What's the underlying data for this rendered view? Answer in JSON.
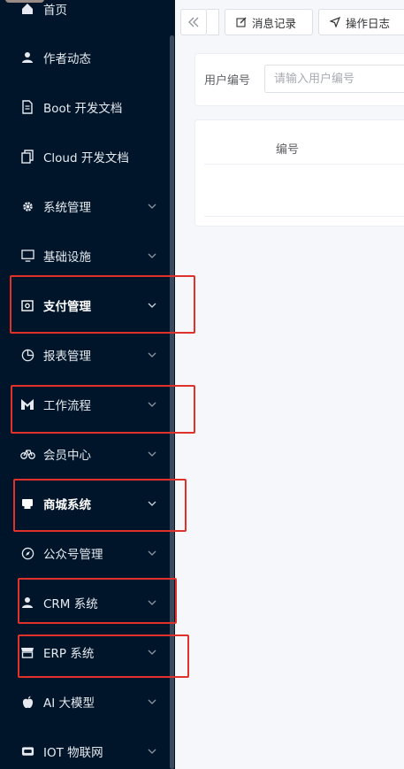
{
  "sidebar": {
    "items": [
      {
        "label": "首页",
        "icon": "home-icon",
        "bold": false,
        "has_arrow": false
      },
      {
        "label": "作者动态",
        "icon": "user-icon",
        "bold": false,
        "has_arrow": false
      },
      {
        "label": "Boot 开发文档",
        "icon": "document-icon",
        "bold": false,
        "has_arrow": false
      },
      {
        "label": "Cloud 开发文档",
        "icon": "copy-document-icon",
        "bold": false,
        "has_arrow": false
      },
      {
        "label": "系统管理",
        "icon": "gear-icon",
        "bold": false,
        "has_arrow": true
      },
      {
        "label": "基础设施",
        "icon": "monitor-icon",
        "bold": false,
        "has_arrow": true
      },
      {
        "label": "支付管理",
        "icon": "wallet-icon",
        "bold": true,
        "has_arrow": true
      },
      {
        "label": "报表管理",
        "icon": "pie-chart-icon",
        "bold": false,
        "has_arrow": true
      },
      {
        "label": "工作流程",
        "icon": "flow-icon",
        "bold": false,
        "has_arrow": true
      },
      {
        "label": "会员中心",
        "icon": "bicycle-icon",
        "bold": false,
        "has_arrow": true
      },
      {
        "label": "商城系统",
        "icon": "shop-icon",
        "bold": true,
        "has_arrow": true
      },
      {
        "label": "公众号管理",
        "icon": "compass-icon",
        "bold": false,
        "has_arrow": true
      },
      {
        "label": "CRM 系统",
        "icon": "user-icon",
        "bold": false,
        "has_arrow": true
      },
      {
        "label": "ERP 系统",
        "icon": "store-icon",
        "bold": false,
        "has_arrow": true
      },
      {
        "label": "AI 大模型",
        "icon": "apple-icon",
        "bold": false,
        "has_arrow": true
      },
      {
        "label": "IOT 物联网",
        "icon": "chip-icon",
        "bold": false,
        "has_arrow": true
      }
    ]
  },
  "tabs": {
    "message_record": "消息记录",
    "operation_log": "操作日志"
  },
  "search": {
    "label": "用户编号",
    "placeholder": "请输入用户编号"
  },
  "table": {
    "column_number": "编号"
  },
  "colors": {
    "sidebar_bg": "#001529",
    "highlight": "#e0322b"
  }
}
